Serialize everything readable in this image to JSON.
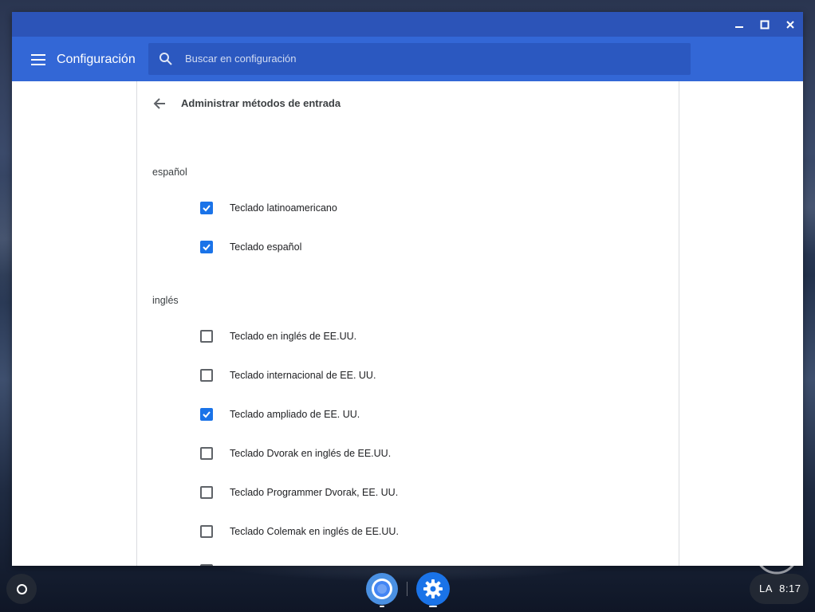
{
  "window": {
    "controls": {
      "minimize_icon": "minimize-icon",
      "maximize_icon": "maximize-icon",
      "close_icon": "close-icon"
    }
  },
  "header": {
    "menu_icon": "hamburger-menu-icon",
    "title": "Configuración",
    "search": {
      "icon": "search-icon",
      "placeholder": "Buscar en configuración"
    }
  },
  "page": {
    "back_icon": "arrow-back-icon",
    "title": "Administrar métodos de entrada",
    "sections": [
      {
        "label": "español",
        "items": [
          {
            "label": "Teclado latinoamericano",
            "checked": true
          },
          {
            "label": "Teclado español",
            "checked": true
          }
        ]
      },
      {
        "label": "inglés",
        "items": [
          {
            "label": "Teclado en inglés de EE.UU.",
            "checked": false
          },
          {
            "label": "Teclado internacional de EE. UU.",
            "checked": false
          },
          {
            "label": "Teclado ampliado de EE. UU.",
            "checked": true
          },
          {
            "label": "Teclado Dvorak en inglés de EE.UU.",
            "checked": false
          },
          {
            "label": "Teclado Programmer Dvorak, EE. UU.",
            "checked": false
          },
          {
            "label": "Teclado Colemak en inglés de EE.UU.",
            "checked": false
          }
        ]
      }
    ]
  },
  "shelf": {
    "launcher_icon": "launcher-circle-icon",
    "apps": [
      {
        "name": "chrome",
        "icon": "chrome-icon",
        "running": true
      },
      {
        "name": "settings",
        "icon": "gear-icon",
        "running": true
      }
    ],
    "status": {
      "ime": "LA",
      "time": "8:17"
    }
  },
  "colors": {
    "titlebar": "#2c54b8",
    "appbar": "#3367d6",
    "search_bg": "#2b58c0",
    "checkbox_checked": "#1a73e8",
    "text_primary": "#202124"
  }
}
